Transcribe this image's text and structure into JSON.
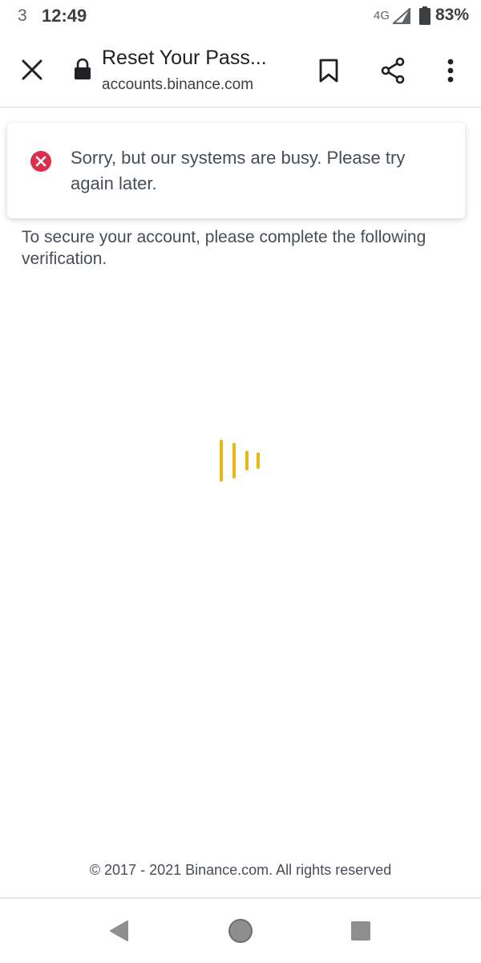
{
  "status_bar": {
    "notification_count": "3",
    "time": "12:49",
    "network": "4G",
    "battery": "83%"
  },
  "toolbar": {
    "title": "Reset Your Pass...",
    "url": "accounts.binance.com",
    "icons": [
      "close-icon",
      "lock-icon",
      "bookmark-icon",
      "share-icon",
      "more-vert-icon"
    ]
  },
  "toast": {
    "message": "Sorry, but our systems are busy. Please try again later.",
    "icon": "error-icon",
    "icon_color": "#d9304e"
  },
  "page": {
    "instruction": "To secure your account, please complete the following verification.",
    "loader_color": "#e8b816"
  },
  "footer": {
    "copyright": "© 2017 - 2021 Binance.com. All rights reserved"
  },
  "nav_bar": {
    "icons": [
      "back-icon",
      "home-icon",
      "recents-icon"
    ]
  }
}
